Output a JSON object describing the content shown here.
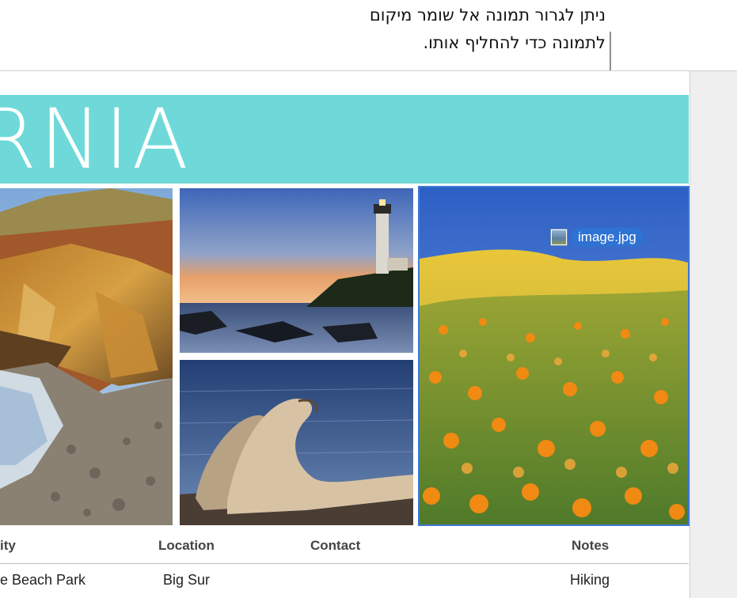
{
  "callout": {
    "line1": "ניתן לגרור תמונה אל שומר מיקום",
    "line2": "לתמונה כדי להחליף אותו."
  },
  "banner": {
    "title": "RNIA"
  },
  "drag": {
    "filename": "image.jpg",
    "icon": "image-file-icon"
  },
  "table": {
    "headers": [
      "ity",
      "Location",
      "Contact",
      "Notes"
    ],
    "rows": [
      [
        "e Beach Park",
        "Big Sur",
        "",
        "Hiking"
      ]
    ]
  },
  "colors": {
    "banner": "#6fd9d9",
    "selection": "#3c7ad6",
    "pill": "#2e72d2"
  }
}
